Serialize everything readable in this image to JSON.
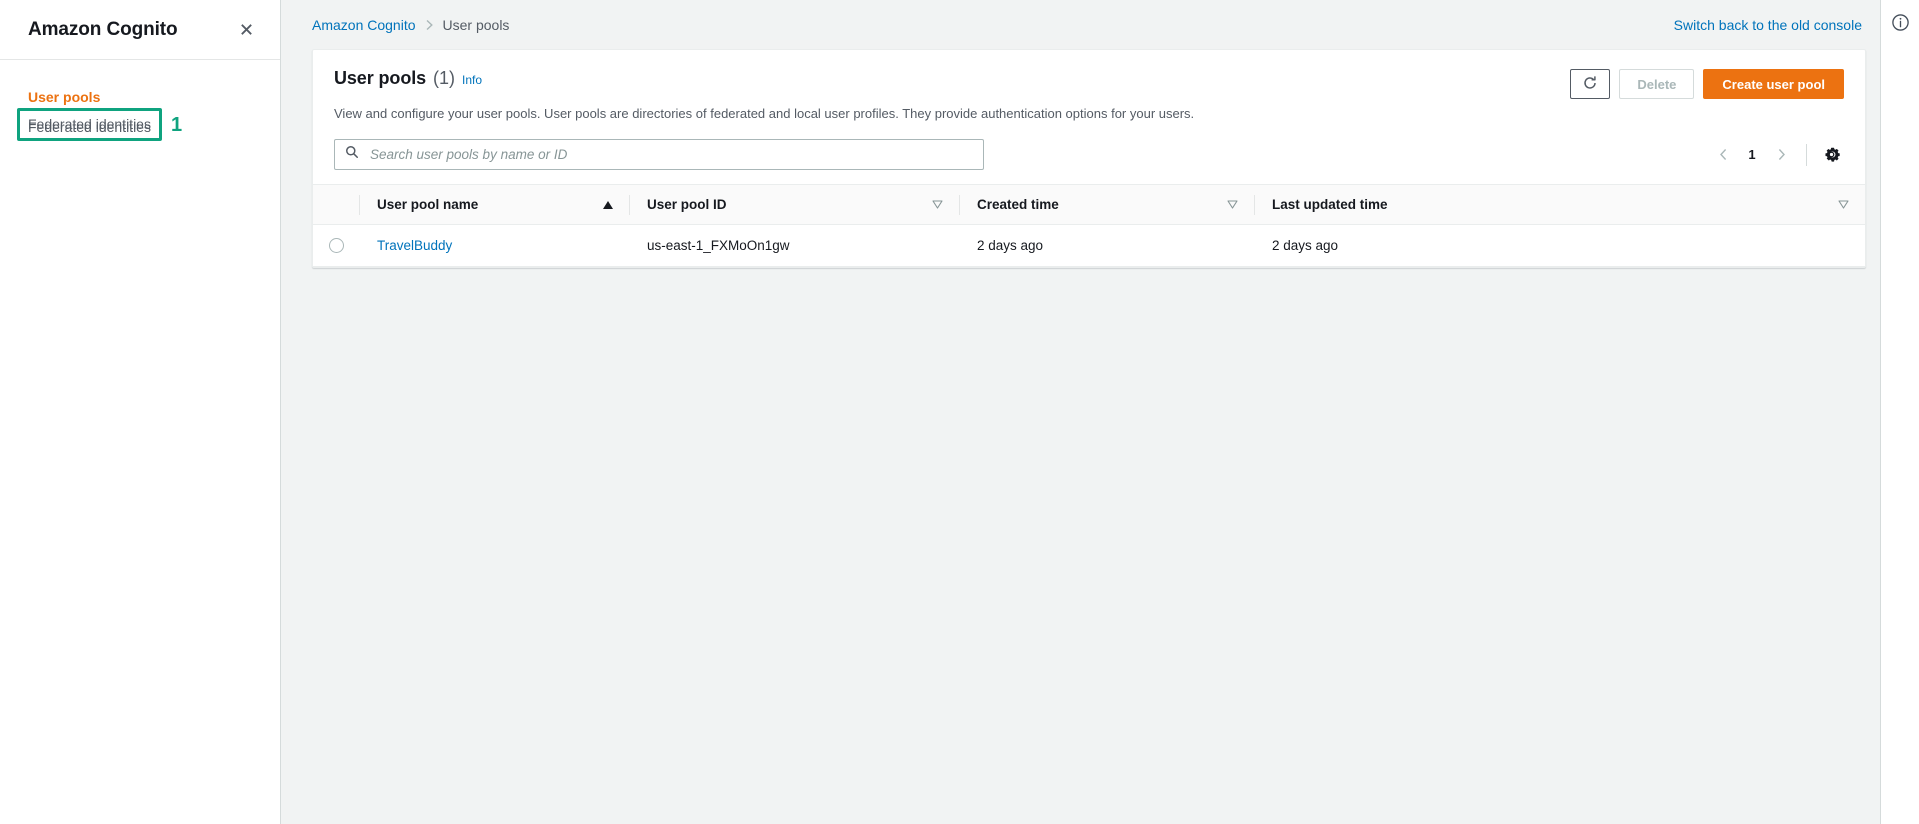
{
  "sidebar": {
    "title": "Amazon Cognito",
    "close_icon": "close-icon",
    "items": [
      {
        "label": "User pools",
        "active": true
      },
      {
        "label": "Federated identities",
        "active": false
      }
    ]
  },
  "annotation": {
    "number": "1",
    "target_label": "Federated identities",
    "color": "#0fa37f"
  },
  "topbar": {
    "breadcrumb": [
      {
        "label": "Amazon Cognito",
        "is_link": true
      },
      {
        "label": "User pools",
        "is_link": false
      }
    ],
    "separator": "›",
    "switch_console_link": "Switch back to the old console"
  },
  "right_rail": {
    "info_icon": "info-circle-icon"
  },
  "card": {
    "title": "User pools",
    "count": "(1)",
    "info_label": "Info",
    "description": "View and configure your user pools. User pools are directories of federated and local user profiles. They provide authentication options for your users.",
    "actions": {
      "refresh_icon": "refresh-icon",
      "delete_label": "Delete",
      "create_label": "Create user pool"
    },
    "search": {
      "placeholder": "Search user pools by name or ID",
      "value": "",
      "icon": "search-icon"
    },
    "pagination": {
      "prev_icon": "chevron-left-icon",
      "next_icon": "chevron-right-icon",
      "current_page": "1",
      "settings_icon": "gear-icon"
    },
    "table": {
      "columns": [
        {
          "label": "User pool name",
          "sort": "asc"
        },
        {
          "label": "User pool ID",
          "sort": "none"
        },
        {
          "label": "Created time",
          "sort": "none"
        },
        {
          "label": "Last updated time",
          "sort": "none"
        }
      ],
      "rows": [
        {
          "selected": false,
          "name": "TravelBuddy",
          "id": "us-east-1_FXMoOn1gw",
          "created_time": "2 days ago",
          "last_updated_time": "2 days ago"
        }
      ]
    }
  },
  "colors": {
    "brand_orange": "#ec7211",
    "link_blue": "#0073bb",
    "annotation_green": "#0fa37f",
    "page_bg": "#f1f3f3"
  }
}
